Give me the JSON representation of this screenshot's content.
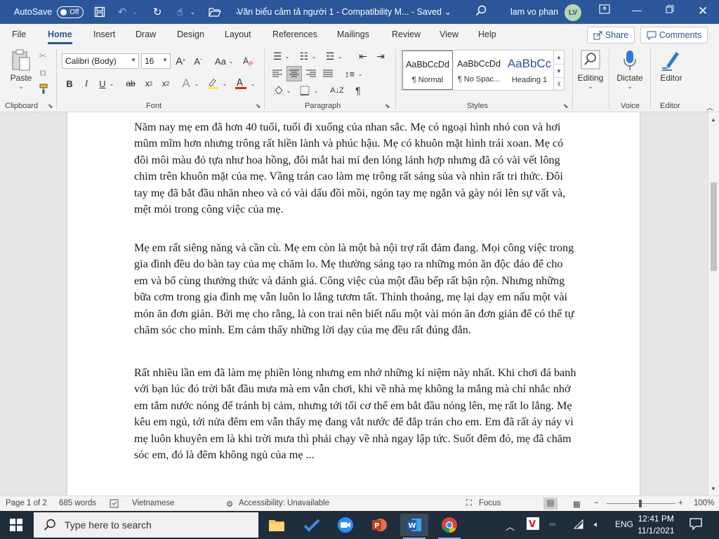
{
  "titlebar": {
    "autosave_label": "AutoSave",
    "autosave_state": "Off",
    "doc_title": "Văn biểu cảm tả người 1  -  Compatibility M...  -  Saved",
    "saved_caret": "⌄",
    "user_name": "lam vo phan",
    "user_initials": "LV"
  },
  "tabs": [
    "File",
    "Home",
    "Insert",
    "Draw",
    "Design",
    "Layout",
    "References",
    "Mailings",
    "Review",
    "View",
    "Help"
  ],
  "active_tab": "Home",
  "share_label": "Share",
  "comments_label": "Comments",
  "ribbon": {
    "clipboard": {
      "paste_label": "Paste",
      "group_label": "Clipboard"
    },
    "font": {
      "font_name": "Calibri (Body)",
      "font_size": "16",
      "group_label": "Font"
    },
    "paragraph": {
      "group_label": "Paragraph"
    },
    "styles": {
      "group_label": "Styles",
      "items": [
        {
          "preview": "AaBbCcDd",
          "name": "¶ Normal"
        },
        {
          "preview": "AaBbCcDd",
          "name": "¶ No Spac..."
        },
        {
          "preview": "AaBbCc",
          "name": "Heading 1"
        }
      ]
    },
    "editing_label": "Editing",
    "voice": {
      "dictate_label": "Dictate",
      "group_label": "Voice"
    },
    "editor": {
      "editor_label": "Editor",
      "group_label": "Editor"
    }
  },
  "document": {
    "paragraphs": [
      "Năm nay mẹ em đã hơn 40 tuổi, tuổi đi xuống của  nhan sắc. Mẹ có ngoại hình nhỏ con và hơi mũm mĩm hơn nhưng trông rất hiền lành và phúc hậu. Mẹ có khuôn mặt hình trái xoan. Mẹ có đôi môi màu đỏ tựa như hoa hồng, đôi mắt hai mí đen lóng lánh hợp nhưng đã có vài vết lông chim trên khuôn mặt của mẹ. Vầng trán cao làm mẹ trông rất sáng sủa và nhìn rất tri thức. Đôi tay mẹ đã bắt đầu nhăn nheo và có vài dấu đồi mồi, ngón tay mẹ ngắn và gày nói lên sự vất và, mệt mỏi trong công việc của mẹ.",
      "Mẹ em rất siêng năng và cần cù. Mẹ em còn là một bà nội trợ rất đảm đang. Mọi công việc trong gia đình đều do bàn tay của mẹ chăm lo. Mẹ thường sáng tạo ra những món ăn độc đáo để cho em và bố cùng thưởng thức và đánh giá. Công việc của một đầu bếp rất bận rộn. Nhưng những bữa cơm trong gia đình mẹ vẫn luôn lo lắng tươm tất. Thỉnh thoảng, mẹ lại dạy em nấu một vài món ăn đơn giản. Bởi mẹ cho rằng, là con trai nên biết nấu một vài món ăn đơn giản để có thể tự chăm sóc cho mình. Em cảm thấy những lời dạy của mẹ đều rất đúng đắn.",
      "Rất nhiều lần em đã làm mẹ phiền lòng nhưng em nhớ những kỉ niệm này nhất. Khi chơi đá banh với bạn lúc đó trời bắt đầu mưa mà em vẫn chơi, khi về nhà mẹ không la mắng mà chỉ nhắc nhở em tắm nước nóng để tránh bị cảm, nhưng tới tối cơ thể em bắt đầu nóng lên, mẹ rất lo lắng. Mẹ kêu em ngủ, tới nửa đêm em vẫn thấy mẹ đang vắt nước để đắp trán cho em. Em đã rất áy náy vì mẹ luôn khuyên em là khi trời mưa thì phải chạy về nhà ngay lập tức. Suốt đêm đó, mẹ đã chăm sóc em, đó là đêm không ngủ của mẹ ..."
    ]
  },
  "statusbar": {
    "page": "Page 1 of 2",
    "words": "685 words",
    "language": "Vietnamese",
    "accessibility": "Accessibility: Unavailable",
    "focus": "Focus",
    "zoom": "100%"
  },
  "taskbar": {
    "search_placeholder": "Type here to search",
    "language": "ENG",
    "time": "12:41 PM",
    "date": "11/1/2021"
  },
  "colors": {
    "accent": "#2b579a",
    "taskbar": "#1f2d3d"
  }
}
